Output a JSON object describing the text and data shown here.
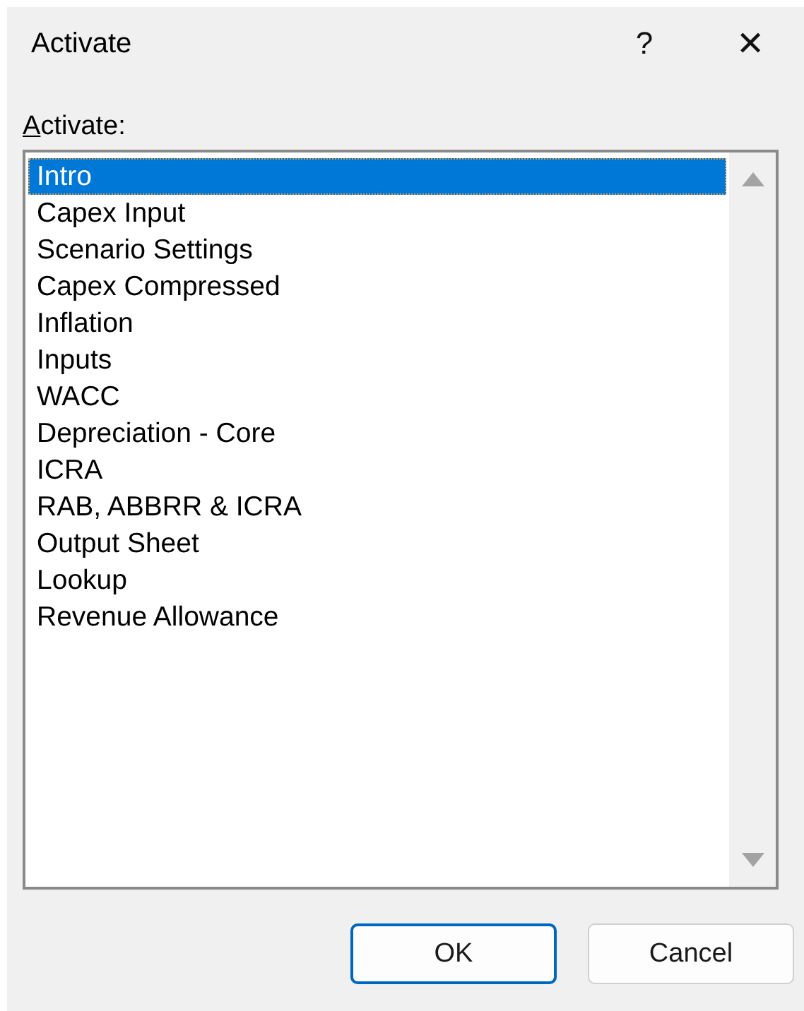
{
  "window": {
    "title": "Activate",
    "help": "?",
    "close": "✕"
  },
  "label": "Activate:",
  "sheets": [
    {
      "name": "Intro",
      "selected": true
    },
    {
      "name": "Capex Input",
      "selected": false
    },
    {
      "name": "Scenario Settings",
      "selected": false
    },
    {
      "name": "Capex Compressed",
      "selected": false
    },
    {
      "name": "Inflation",
      "selected": false
    },
    {
      "name": "Inputs",
      "selected": false
    },
    {
      "name": "WACC",
      "selected": false
    },
    {
      "name": "Depreciation - Core",
      "selected": false
    },
    {
      "name": "ICRA",
      "selected": false
    },
    {
      "name": "RAB, ABBRR & ICRA",
      "selected": false
    },
    {
      "name": "Output Sheet",
      "selected": false
    },
    {
      "name": "Lookup",
      "selected": false
    },
    {
      "name": "Revenue Allowance",
      "selected": false
    }
  ],
  "buttons": [
    {
      "label": "OK",
      "kind": "default"
    },
    {
      "label": "Cancel",
      "kind": "normal"
    }
  ]
}
